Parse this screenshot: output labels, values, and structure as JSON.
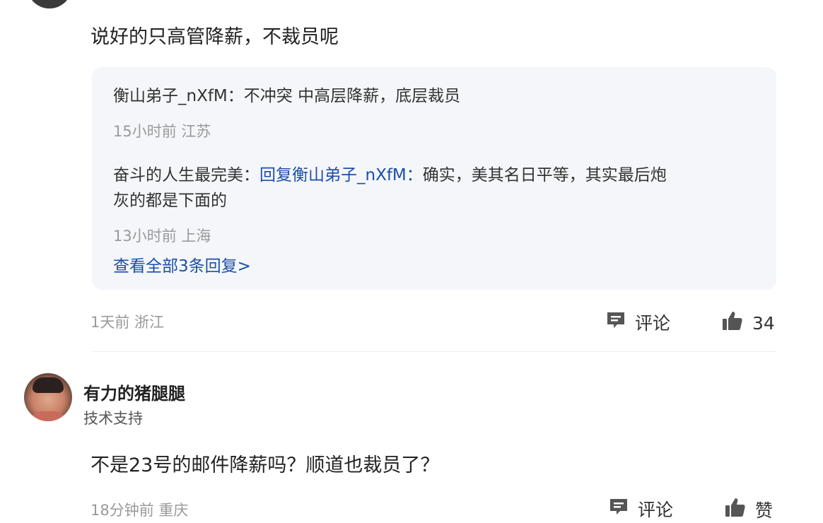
{
  "comment1": {
    "text": "说好的只高管降薪，不裁员呢",
    "replies": [
      {
        "name": "衡山弟子_nXfM：",
        "text": "不冲突 中高层降薪，底层裁员",
        "meta": "15小时前 江苏"
      },
      {
        "name": "奋斗的人生最完美：",
        "reply_to": "回复衡山弟子_nXfM：",
        "text_line1": "确实，美其名日平等，其实最后炮",
        "text_line2": "灰的都是下面的",
        "meta": "13小时前 上海"
      }
    ],
    "view_all": "查看全部3条回复>",
    "meta": "1天前 浙江",
    "comment_label": "评论",
    "like_count": "34"
  },
  "comment2": {
    "username": "有力的猪腿腿",
    "usertitle": "技术支持",
    "text": "不是23号的邮件降薪吗？顺道也裁员了？",
    "meta": "18分钟前 重庆",
    "comment_label": "评论",
    "like_label": "赞"
  },
  "icons": {
    "comment": "comment-icon",
    "like": "thumbs-up-icon"
  },
  "colors": {
    "link": "#1d4fa8",
    "meta": "#9a9a9a",
    "reply_bg": "#f4f6fa"
  }
}
